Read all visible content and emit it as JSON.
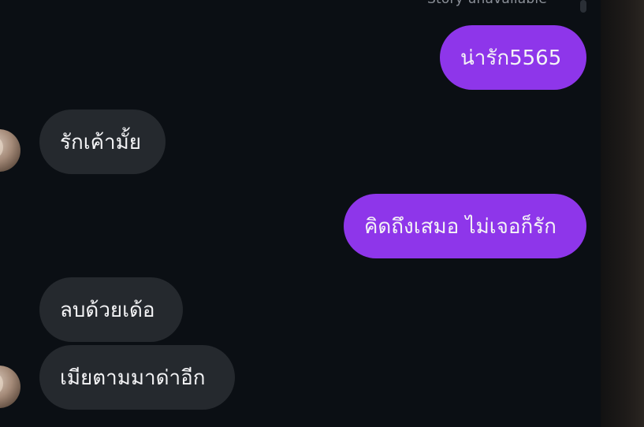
{
  "chat": {
    "story_status": "Story unavailable",
    "messages": [
      {
        "direction": "sent",
        "text": "น่ารัก5565"
      },
      {
        "direction": "received",
        "text": "รักเค้ามั้ย"
      },
      {
        "direction": "sent",
        "text": "คิดถึงเสมอ ไม่เจอก็รัก"
      },
      {
        "direction": "received",
        "text": "ลบด้วยเด้อ"
      },
      {
        "direction": "received",
        "text": "เมียตามมาด่าอีก"
      }
    ]
  },
  "colors": {
    "background": "#0b0f14",
    "sent_bubble": "#8e36ea",
    "received_bubble": "#25292e",
    "text": "#f4f4f6",
    "muted_text": "#8a8f97"
  }
}
